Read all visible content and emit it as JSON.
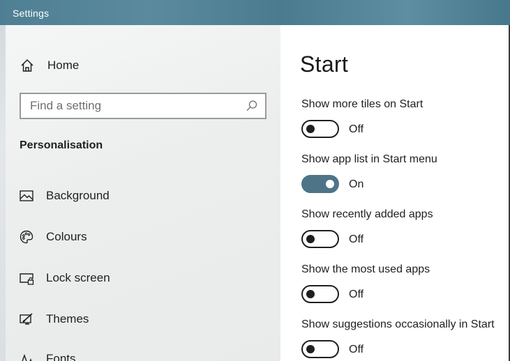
{
  "window": {
    "title": "Settings"
  },
  "sidebar": {
    "home_label": "Home",
    "search_placeholder": "Find a setting",
    "section_title": "Personalisation",
    "items": [
      {
        "label": "Background",
        "icon": "picture-icon"
      },
      {
        "label": "Colours",
        "icon": "palette-icon"
      },
      {
        "label": "Lock screen",
        "icon": "lock-screen-icon"
      },
      {
        "label": "Themes",
        "icon": "themes-brush-icon"
      },
      {
        "label": "Fonts",
        "icon": "fonts-icon"
      }
    ]
  },
  "main": {
    "title": "Start",
    "settings": [
      {
        "label": "Show more tiles on Start",
        "state": "Off"
      },
      {
        "label": "Show app list in Start menu",
        "state": "On"
      },
      {
        "label": "Show recently added apps",
        "state": "Off"
      },
      {
        "label": "Show the most used apps",
        "state": "Off"
      },
      {
        "label": "Show suggestions occasionally in Start",
        "state": "Off"
      }
    ]
  },
  "colors": {
    "titlebar": "#4f7f93",
    "toggle_on": "#4d7487",
    "text": "#1f1f1f"
  }
}
